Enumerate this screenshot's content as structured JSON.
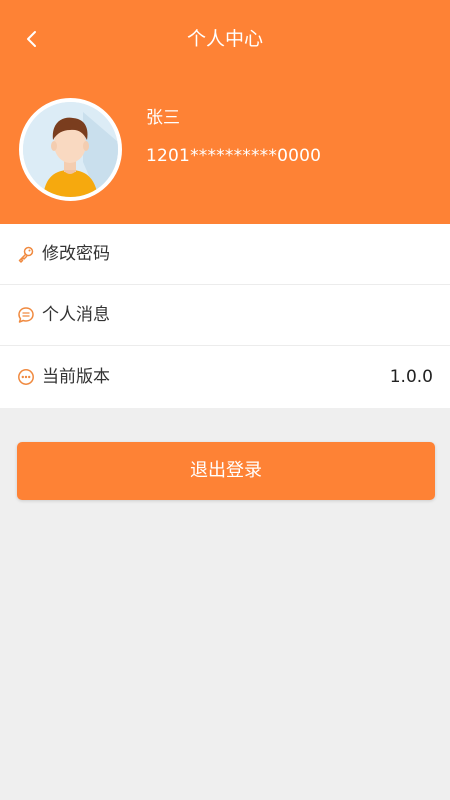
{
  "header": {
    "title": "个人中心",
    "back_icon": "chevron-left-icon"
  },
  "profile": {
    "name": "张三",
    "phone": "1201**********0000",
    "avatar_icon": "avatar-man-icon"
  },
  "menu": {
    "items": [
      {
        "label": "修改密码",
        "icon": "key-icon",
        "value": ""
      },
      {
        "label": "个人消息",
        "icon": "message-icon",
        "value": ""
      },
      {
        "label": "当前版本",
        "icon": "more-dots-icon",
        "value": "1.0.0"
      }
    ]
  },
  "logout": {
    "label": "退出登录"
  },
  "colors": {
    "accent": "#fe8235",
    "background": "#efefef",
    "card": "#ffffff",
    "text": "#333333"
  }
}
